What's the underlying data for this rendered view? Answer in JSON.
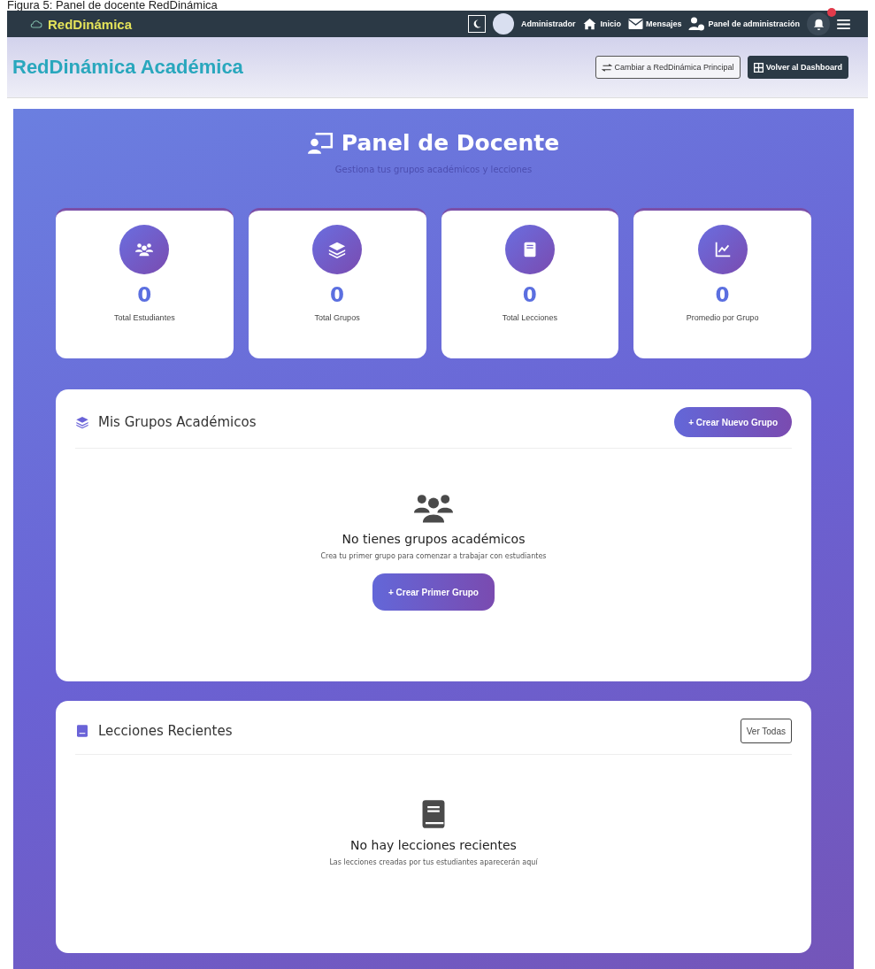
{
  "caption": "Figura 5: Panel de docente RedDinámica",
  "navbar": {
    "brand": "RedDinámica",
    "user": "Administrador",
    "links": [
      {
        "label": "Inicio",
        "kind": "home"
      },
      {
        "label": "Mensajes",
        "kind": "mail"
      },
      {
        "label": "Panel de administración",
        "kind": "admin"
      }
    ],
    "notification_badge": true
  },
  "header": {
    "title": "RedDinámica Académica",
    "buttons": [
      {
        "label": "Cambiar a RedDinámica Principal",
        "kind": "outline"
      },
      {
        "label": "Volver al Dashboard",
        "kind": "dark"
      }
    ]
  },
  "panel": {
    "title": "Panel de Docente",
    "subtitle": "Gestiona tus grupos académicos y lecciones",
    "stats": [
      {
        "value": "0",
        "label": "Total Estudiantes",
        "kind": "users"
      },
      {
        "value": "0",
        "label": "Total Grupos",
        "kind": "layers"
      },
      {
        "value": "0",
        "label": "Total Lecciones",
        "kind": "book"
      },
      {
        "value": "0",
        "label": "Promedio por Grupo",
        "kind": "chart"
      }
    ],
    "sections": [
      {
        "title": "Mis Grupos Académicos",
        "kind": "layers",
        "action": {
          "label": "+ Crear Nuevo Grupo",
          "kind": "gradient"
        },
        "empty_title": "No tienes grupos académicos",
        "empty_text": "Crea tu primer grupo para comenzar a trabajar con estudiantes",
        "empty_button": "+ Crear Primer Grupo"
      },
      {
        "title": "Lecciones Recientes",
        "kind": "book",
        "action": {
          "label": "Ver Todas",
          "kind": "outline"
        },
        "empty_title": "No hay lecciones recientes",
        "empty_text": "Las lecciones creadas por tus estudiantes aparecerán aquí"
      }
    ]
  }
}
